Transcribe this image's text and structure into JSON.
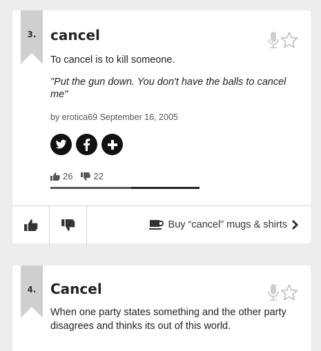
{
  "entries": [
    {
      "rank": "3.",
      "word": "cancel",
      "meaning": "To cancel is to kill someone.",
      "example": "\"Put the gun down. You don't have the balls to cancel me\"",
      "contributor": "by erotica69 September 16, 2005",
      "thumbs_up": "26",
      "thumbs_down": "22",
      "up_fraction": 0.54,
      "shop_label": "Buy “cancel” mugs & shirts"
    },
    {
      "rank": "4.",
      "word": "Cancel",
      "meaning": "When one party states something and the other party disagrees and thinks its out of this world."
    }
  ],
  "icons": {
    "mic": "microphone-icon",
    "star": "star-outline-icon",
    "share": [
      "twitter-icon",
      "facebook-icon",
      "plus-icon"
    ],
    "thumb_up": "thumbs-up-icon",
    "thumb_down": "thumbs-down-icon",
    "mug": "mug-icon",
    "chevron": "chevron-right-icon"
  },
  "colors": {
    "background": "#ededed",
    "card": "#ffffff",
    "ribbon": "#cfcfcf",
    "share_button": "#111111"
  }
}
